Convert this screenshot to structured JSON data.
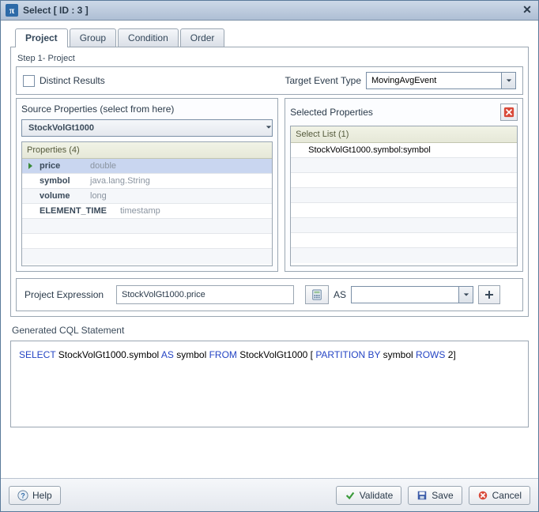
{
  "window": {
    "title": "Select [ ID : 3 ]"
  },
  "tabs": {
    "project": "Project",
    "group": "Group",
    "condition": "Condition",
    "order": "Order"
  },
  "step_label": "Step 1- Project",
  "distinct": {
    "label": "Distinct Results"
  },
  "target_event": {
    "label": "Target Event Type",
    "value": "MovingAvgEvent"
  },
  "source_panel": {
    "title": "Source Properties (select from here)",
    "stream": "StockVolGt1000",
    "grid_header": "Properties (4)",
    "rows": [
      {
        "name": "price",
        "type": "double"
      },
      {
        "name": "symbol",
        "type": "java.lang.String"
      },
      {
        "name": "volume",
        "type": "long"
      },
      {
        "name": "ELEMENT_TIME",
        "type": "timestamp"
      }
    ]
  },
  "selected_panel": {
    "title": "Selected Properties",
    "grid_header": "Select List (1)",
    "rows": [
      {
        "text": "StockVolGt1000.symbol:symbol"
      }
    ]
  },
  "expr": {
    "label": "Project Expression",
    "value": "StockVolGt1000.price",
    "as_label": "AS",
    "as_value": ""
  },
  "generated": {
    "label": "Generated CQL Statement",
    "tokens": {
      "select": "SELECT",
      "col": " StockVolGt1000.symbol ",
      "as": "AS",
      "alias": " symbol ",
      "from": "FROM",
      "src": " StockVolGt1000  [ ",
      "part": "PARTITION BY",
      "partcol": " symbol  ",
      "rows": "ROWS",
      "nrows": " 2]"
    }
  },
  "buttons": {
    "help": "Help",
    "validate": "Validate",
    "save": "Save",
    "cancel": "Cancel"
  }
}
